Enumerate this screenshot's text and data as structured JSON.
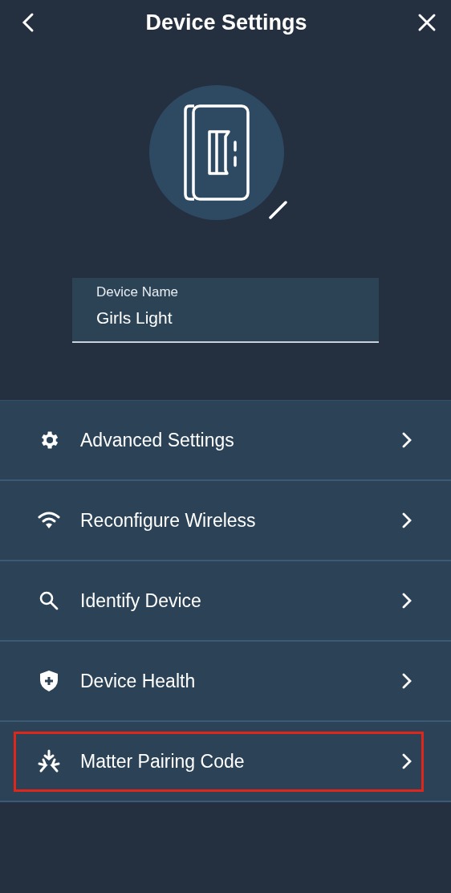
{
  "header": {
    "title": "Device Settings"
  },
  "device_name": {
    "label": "Device Name",
    "value": "Girls Light"
  },
  "menu": [
    {
      "label": "Advanced Settings",
      "kind": "gear",
      "highlighted": false
    },
    {
      "label": "Reconfigure Wireless",
      "kind": "wifi",
      "highlighted": false
    },
    {
      "label": "Identify Device",
      "kind": "search",
      "highlighted": false
    },
    {
      "label": "Device Health",
      "kind": "shield",
      "highlighted": false
    },
    {
      "label": "Matter Pairing Code",
      "kind": "matter",
      "highlighted": true
    }
  ]
}
